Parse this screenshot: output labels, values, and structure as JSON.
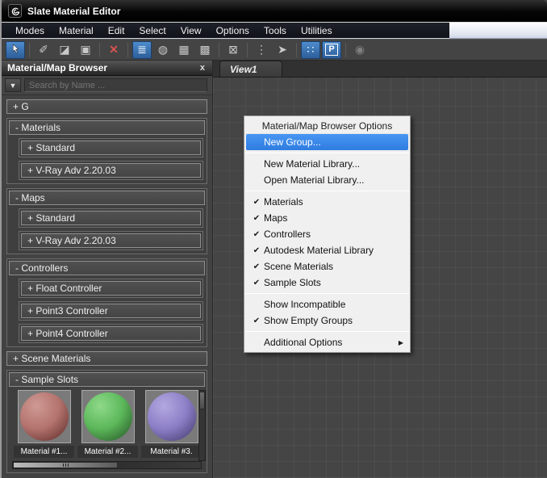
{
  "window": {
    "title": "Slate Material Editor"
  },
  "menubar": {
    "items": [
      "Modes",
      "Material",
      "Edit",
      "Select",
      "View",
      "Options",
      "Tools",
      "Utilities"
    ]
  },
  "toolbar": {
    "buttons": [
      {
        "name": "select-tool",
        "glyph": "",
        "active": true
      },
      {
        "name": "pick-material-eyedropper",
        "glyph": "✐",
        "active": false
      },
      {
        "name": "assign-material-to-selection",
        "glyph": "◪",
        "active": false
      },
      {
        "name": "put-material-to-scene",
        "glyph": "▣",
        "active": false
      },
      {
        "name": "delete-selected",
        "glyph": "✕",
        "active": false
      },
      {
        "name": "layout-children",
        "glyph": "≣",
        "active": true
      },
      {
        "name": "hide-unused-nodeslots",
        "glyph": "◍",
        "active": false
      },
      {
        "name": "show-background",
        "glyph": "▦",
        "active": false
      },
      {
        "name": "show-grid",
        "glyph": "▩",
        "active": false
      },
      {
        "name": "material-id-channel",
        "glyph": "⊠",
        "active": false
      },
      {
        "name": "layout-flyout",
        "glyph": "⋮",
        "active": false
      },
      {
        "name": "connector-arrow",
        "glyph": "➤",
        "active": false
      },
      {
        "name": "pan-to-selected",
        "glyph": "∷",
        "active": true
      },
      {
        "name": "parameter-editor",
        "glyph": "P",
        "active": true
      },
      {
        "name": "get-material-from-object",
        "glyph": "◉",
        "active": false,
        "disabled": true
      }
    ]
  },
  "browser": {
    "title": "Material/Map Browser",
    "close_label": "x",
    "search_placeholder": "Search by Name ...",
    "filter_glyph": "▼",
    "g_section": "+ G",
    "groups": [
      {
        "header": "- Materials",
        "items": [
          "+ Standard",
          "+ V-Ray Adv 2.20.03"
        ]
      },
      {
        "header": "- Maps",
        "items": [
          "+ Standard",
          "+ V-Ray Adv 2.20.03"
        ]
      },
      {
        "header": "- Controllers",
        "items": [
          "+ Float Controller",
          "+ Point3 Controller",
          "+ Point4 Controller"
        ]
      }
    ],
    "scene_materials": "+ Scene Materials",
    "sample_slots": {
      "header": "- Sample Slots",
      "slots": [
        {
          "label": "Material #1...",
          "colors": {
            "hi": "#cf9a94",
            "base": "#b4736e",
            "dark": "#7e4743"
          }
        },
        {
          "label": "Material #2...",
          "colors": {
            "hi": "#8fd98a",
            "base": "#5cb85a",
            "dark": "#3a7a3a"
          }
        },
        {
          "label": "Material #3.",
          "colors": {
            "hi": "#b3a8e0",
            "base": "#8d7fc7",
            "dark": "#5f5490"
          }
        }
      ]
    }
  },
  "view": {
    "tab": "View1"
  },
  "context_menu": {
    "header": "Material/Map Browser Options",
    "items": [
      {
        "label": "New Group...",
        "check": "",
        "arrow": ""
      },
      {
        "label": "New Material Library...",
        "check": "",
        "arrow": ""
      },
      {
        "label": "Open Material Library...",
        "check": "",
        "arrow": ""
      },
      {
        "label": "Materials",
        "check": "✔",
        "arrow": ""
      },
      {
        "label": "Maps",
        "check": "✔",
        "arrow": ""
      },
      {
        "label": "Controllers",
        "check": "✔",
        "arrow": ""
      },
      {
        "label": "Autodesk Material Library",
        "check": "✔",
        "arrow": ""
      },
      {
        "label": "Scene Materials",
        "check": "✔",
        "arrow": ""
      },
      {
        "label": "Sample Slots",
        "check": "✔",
        "arrow": ""
      },
      {
        "label": "Show Incompatible",
        "check": "",
        "arrow": ""
      },
      {
        "label": "Show Empty Groups",
        "check": "✔",
        "arrow": ""
      },
      {
        "label": "Additional Options",
        "check": "",
        "arrow": "▶"
      }
    ]
  },
  "colors": {
    "accent_blue": "#3a77bf",
    "menu_highlight": "#3a8bf0",
    "window_bg": "#444444",
    "canvas_bg": "#454545",
    "context_menu_bg": "#f0f0f0"
  }
}
